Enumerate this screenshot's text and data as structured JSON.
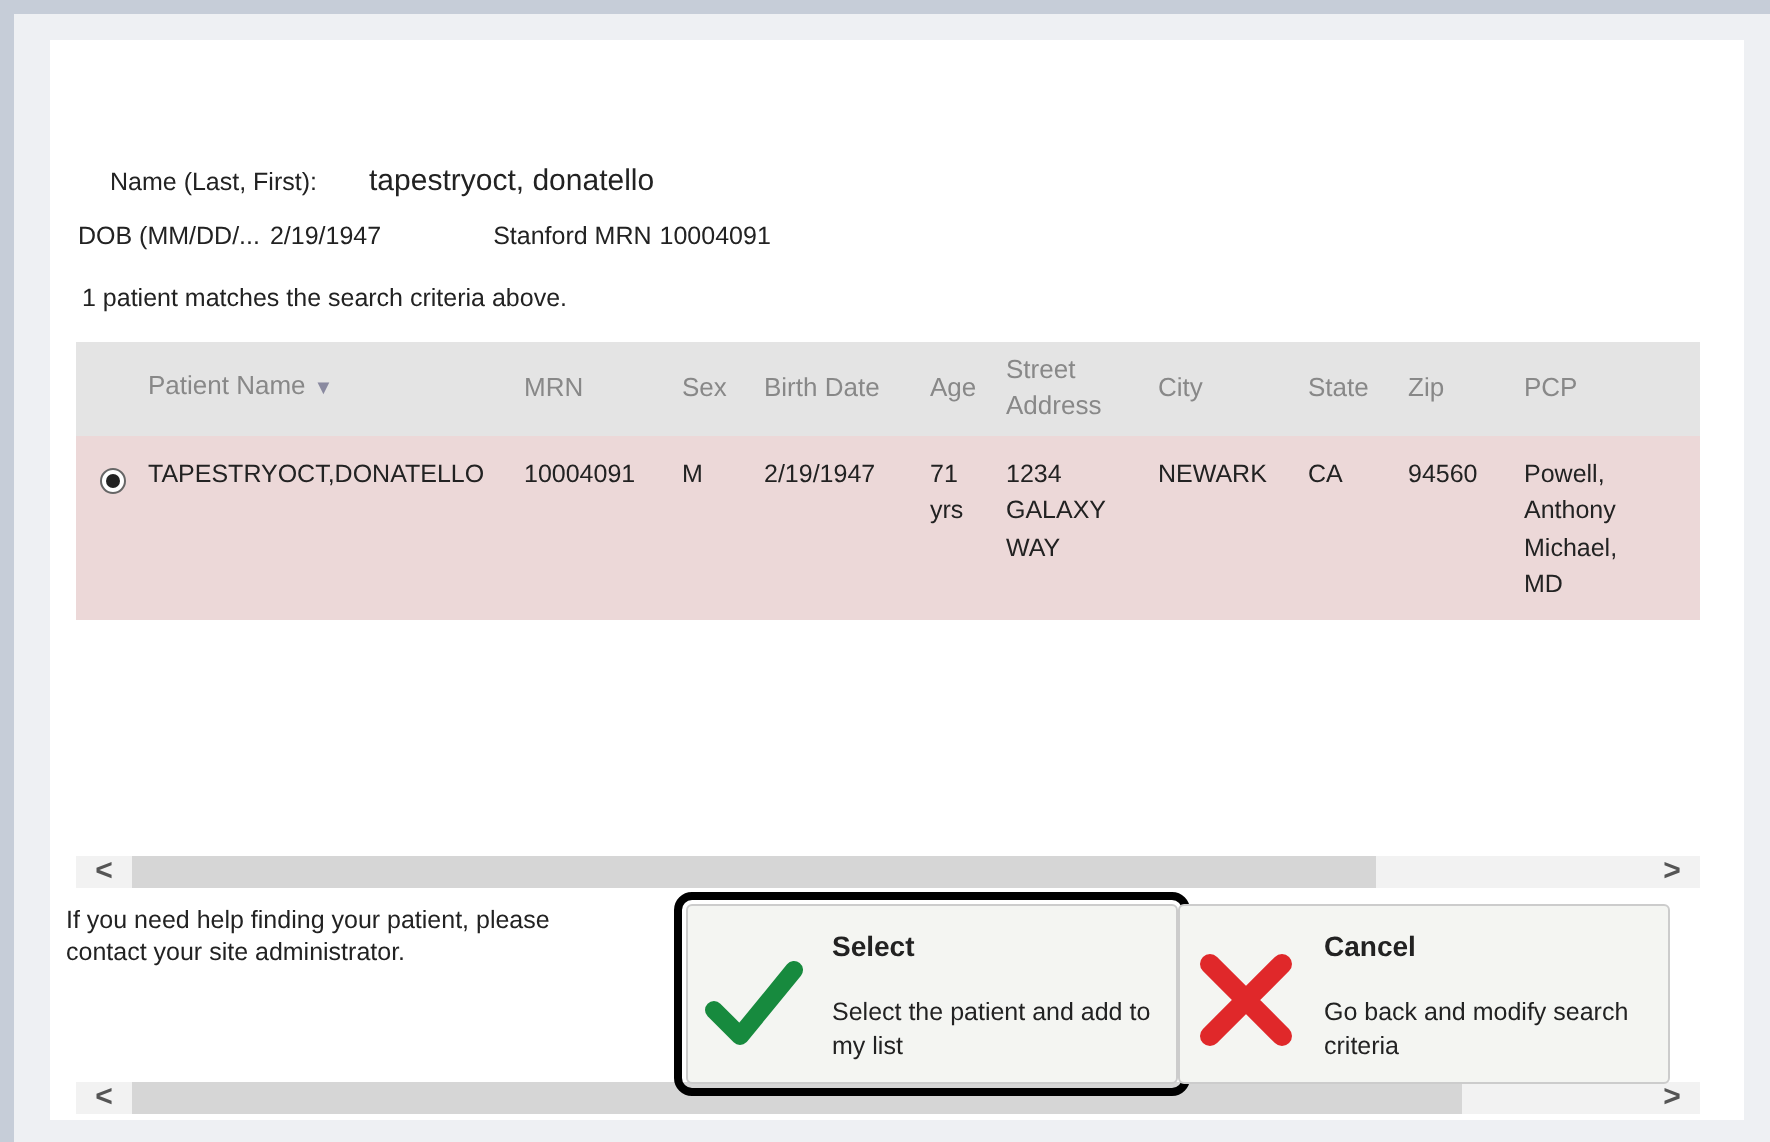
{
  "search": {
    "name_label": "Name (Last, First):",
    "name_value": "tapestryoct, donatello",
    "dob_label": "DOB (MM/DD/...",
    "dob_value": "2/19/1947",
    "mrn_label": "Stanford MRN",
    "mrn_value": "10004091",
    "match_text": "1 patient matches the search criteria above."
  },
  "table": {
    "columns": [
      {
        "label": "Patient Name",
        "sort_icon": "▼"
      },
      {
        "label": "MRN"
      },
      {
        "label": "Sex"
      },
      {
        "label": "Birth Date"
      },
      {
        "label": "Age"
      },
      {
        "label": "Street Address"
      },
      {
        "label": "City"
      },
      {
        "label": "State"
      },
      {
        "label": "Zip"
      },
      {
        "label": "PCP"
      }
    ],
    "rows": [
      {
        "selected": true,
        "cells": [
          "TAPESTRYOCT,DONATELLO",
          "10004091",
          "M",
          "2/19/1947",
          "71 yrs",
          "1234 GALAXY WAY",
          "NEWARK",
          "CA",
          "94560",
          "Powell, Anthony Michael, MD"
        ]
      }
    ]
  },
  "help_text": "If you need help finding your patient, please contact your site administrator.",
  "actions": [
    {
      "kind": "select",
      "title": "Select",
      "description": "Select the patient and add to my list",
      "focused": true
    },
    {
      "kind": "cancel",
      "title": "Cancel",
      "description": "Go back and modify search criteria",
      "focused": false
    }
  ],
  "scroll_arrows": {
    "left": "<",
    "right": ">"
  }
}
